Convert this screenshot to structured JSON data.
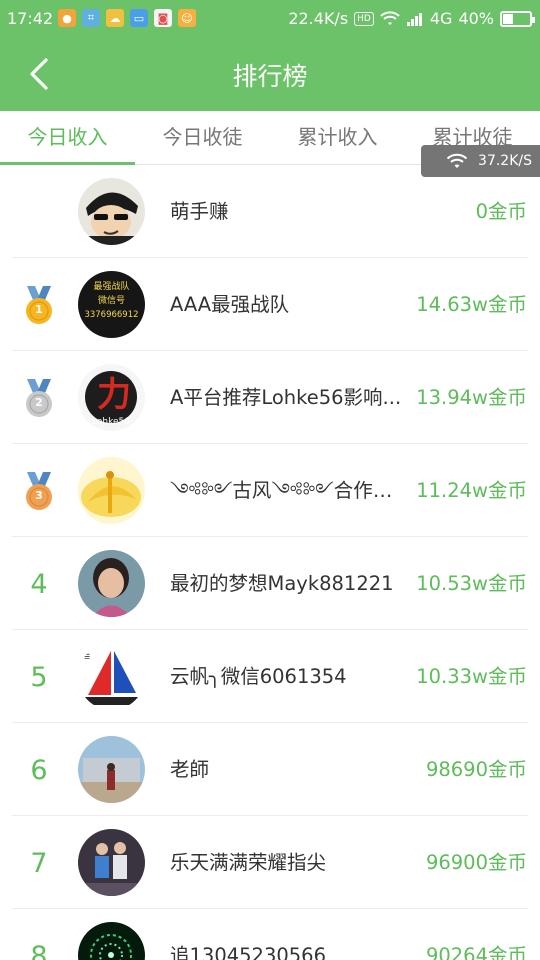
{
  "status_bar": {
    "time": "17:42",
    "net_speed": "22.4K/s",
    "hd": "HD",
    "network": "4G",
    "battery": "40%",
    "battery_level": 0.4
  },
  "header": {
    "title": "排行榜",
    "back_icon": "chevron-left-icon"
  },
  "tabs": [
    {
      "label": "今日收入",
      "active": true
    },
    {
      "label": "今日收徒",
      "active": false
    },
    {
      "label": "累计收入",
      "active": false
    },
    {
      "label": "累计收徒",
      "active": false
    }
  ],
  "net_toast": {
    "speed": "37.2K/S",
    "icon": "wifi-icon"
  },
  "ranking": [
    {
      "rank": "",
      "medal": "none",
      "name": "萌手赚",
      "coins": "0金币",
      "avatar": "cartoon-boy"
    },
    {
      "rank": "1",
      "medal": "gold",
      "name": "AAA最强战队",
      "coins": "14.63w金币",
      "avatar": "text-logo",
      "avatar_text": [
        "最强战队",
        "微信号",
        "3376966912"
      ]
    },
    {
      "rank": "2",
      "medal": "silver",
      "name": "A平台推荐Lohke56影响...",
      "coins": "13.94w金币",
      "avatar": "red-calligraphy",
      "avatar_text": [
        "力",
        "Lohke56"
      ]
    },
    {
      "rank": "3",
      "medal": "bronze",
      "name": "༺༻古风༺༻合作微信sjz...",
      "coins": "11.24w金币",
      "avatar": "yellow-dancer"
    },
    {
      "rank": "4",
      "medal": "none",
      "name": "最初的梦想Mayk881221",
      "coins": "10.53w金币",
      "avatar": "portrait-woman"
    },
    {
      "rank": "5",
      "medal": "none",
      "name": "云帆╮微信6061354",
      "coins": "10.33w金币",
      "avatar": "sail-logo"
    },
    {
      "rank": "6",
      "medal": "none",
      "name": "老師",
      "coins": "98690金币",
      "avatar": "building-photo"
    },
    {
      "rank": "7",
      "medal": "none",
      "name": "乐天满满荣耀指尖",
      "coins": "96900金币",
      "avatar": "couple-photo"
    },
    {
      "rank": "8",
      "medal": "none",
      "name": "追13045230566",
      "coins": "90264金币",
      "avatar": "green-firework"
    }
  ],
  "colors": {
    "primary": "#6cc268",
    "accent_text": "#5ebc5a",
    "gold": "#f5b622",
    "silver": "#c9c9c9",
    "bronze": "#f0a050",
    "medal_ribbon": "#6b9fd3"
  }
}
